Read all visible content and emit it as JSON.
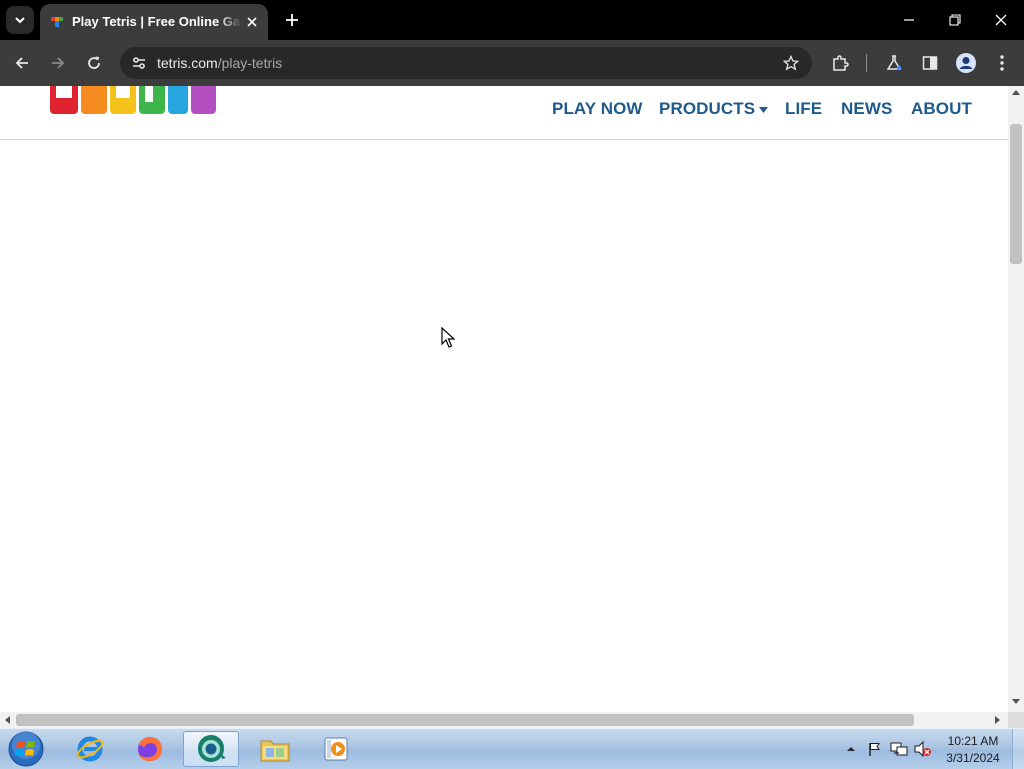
{
  "browser": {
    "tab": {
      "title": "Play Tetris | Free Online Game |"
    },
    "address": {
      "host": "tetris.com",
      "path": "/play-tetris"
    }
  },
  "site": {
    "logo_text": "TETRIS",
    "nav": [
      {
        "label": "PLAY NOW"
      },
      {
        "label": "PRODUCTS",
        "has_dropdown": true
      },
      {
        "label": "LIFE"
      },
      {
        "label": "NEWS"
      },
      {
        "label": "ABOUT"
      }
    ]
  },
  "taskbar": {
    "apps": [
      "internet-explorer",
      "firefox",
      "chrome",
      "file-explorer",
      "media-player"
    ],
    "active_app": "chrome",
    "clock": {
      "time": "10:21 AM",
      "date": "3/31/2024"
    }
  },
  "colors": {
    "nav_text": "#1f5a8a",
    "chrome_dark": "#3c3c3c",
    "tabstrip": "#000000"
  }
}
